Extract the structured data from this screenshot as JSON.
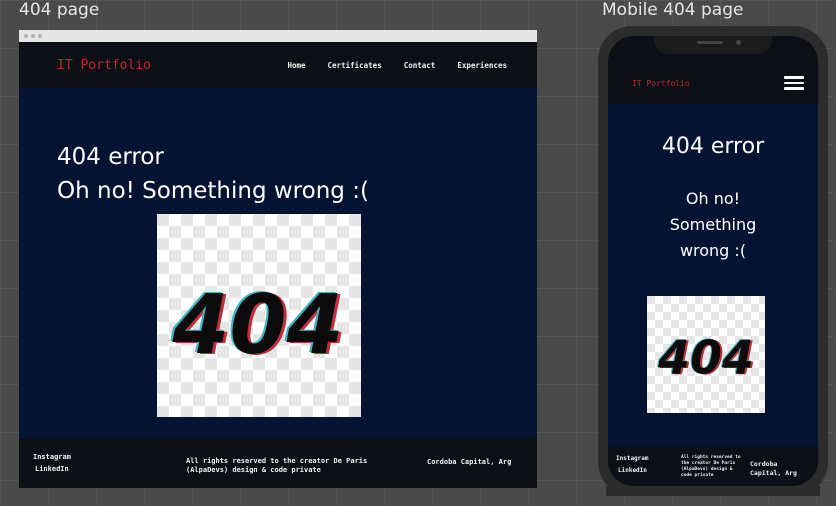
{
  "labels": {
    "desktop": "404 page",
    "mobile": "Mobile 404 page"
  },
  "site": {
    "logo": "IT Portfolio",
    "nav": [
      "Home",
      "Certificates",
      "Contact",
      "Experiences"
    ],
    "error_title": "404 error",
    "error_message": "Oh no! Something wrong :(",
    "mobile_message_lines": [
      "Oh no!",
      "Something",
      "wrong :("
    ],
    "image_text": "404",
    "footer": {
      "social": [
        "Instagram",
        "LinkedIn"
      ],
      "rights_line1": "All rights reserved to the creator De Paris",
      "rights_line2": "(AlpaDevs) design & code private",
      "mobile_rights_lines": [
        "All rights reserved to",
        "the creator De Paris",
        "(AlpaDevs) design &",
        "code private"
      ],
      "location": "Cordoba Capital, Arg",
      "mobile_location_lines": [
        "Cordoba",
        "Capital, Arg"
      ]
    }
  },
  "icons": {
    "menu": "hamburger-menu-icon"
  },
  "colors": {
    "page_bg": "#041331",
    "nav_bg": "#0c0f16",
    "logo": "#c62828",
    "text": "#ffffff"
  }
}
